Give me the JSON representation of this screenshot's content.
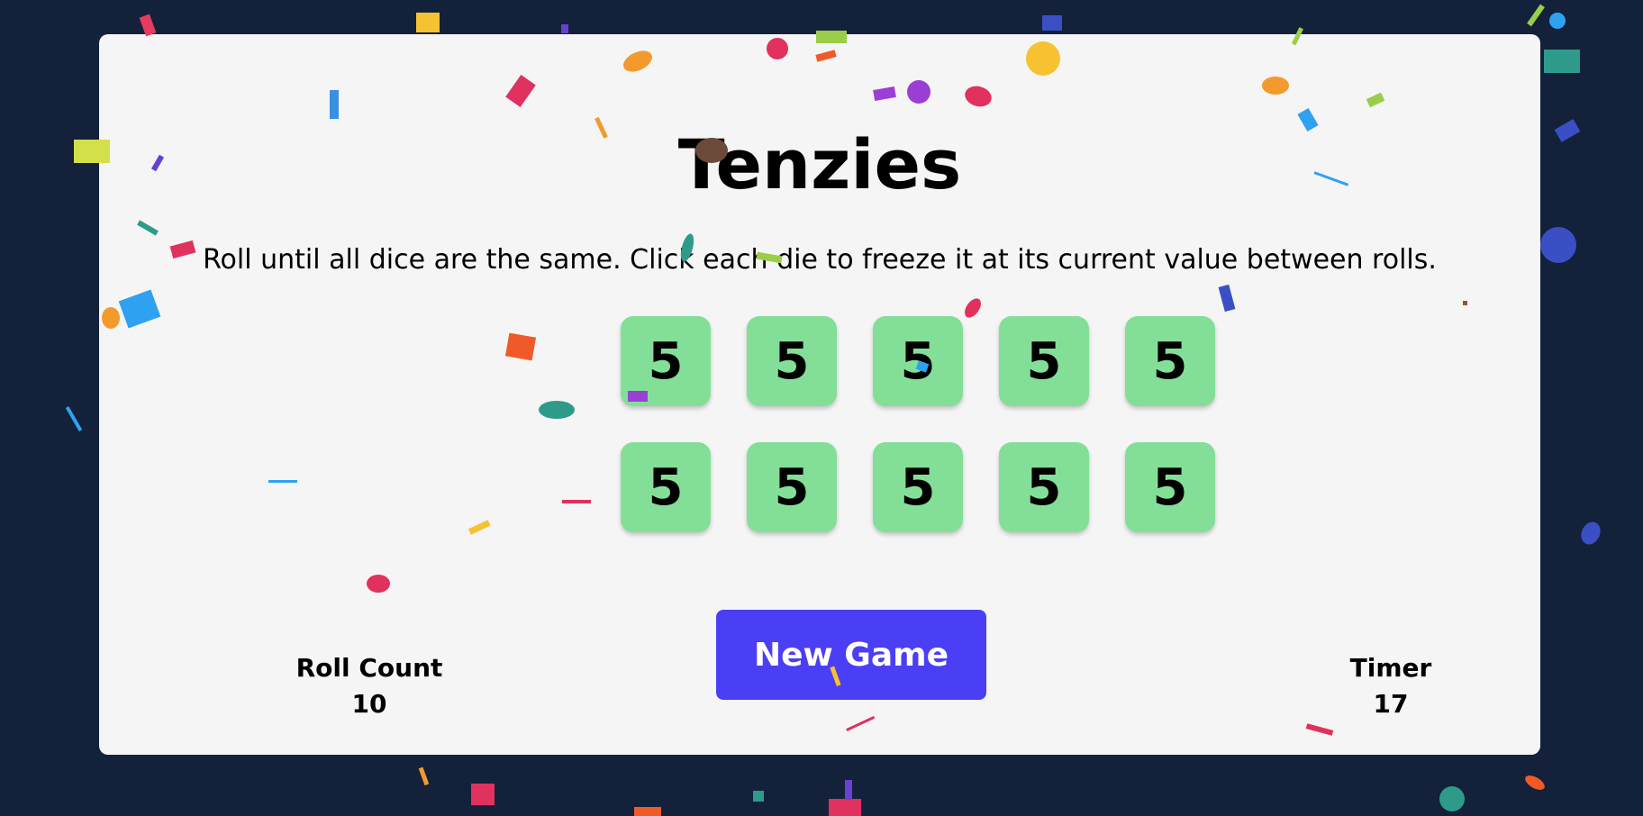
{
  "game": {
    "title": "Tenzies",
    "instructions": "Roll until all dice are the same. Click each die to freeze it at its current value between rolls.",
    "dice": [
      {
        "value": "5",
        "held": true
      },
      {
        "value": "5",
        "held": true
      },
      {
        "value": "5",
        "held": true
      },
      {
        "value": "5",
        "held": true
      },
      {
        "value": "5",
        "held": true
      },
      {
        "value": "5",
        "held": true
      },
      {
        "value": "5",
        "held": true
      },
      {
        "value": "5",
        "held": true
      },
      {
        "value": "5",
        "held": true
      },
      {
        "value": "5",
        "held": true
      }
    ],
    "new_game_label": "New Game",
    "roll_count": {
      "label": "Roll Count",
      "value": "10"
    },
    "timer": {
      "label": "Timer",
      "value": "17"
    }
  },
  "colors": {
    "background": "#13213a",
    "panel": "#f5f5f5",
    "die_held": "#83df98",
    "button": "#4a3ff4"
  }
}
